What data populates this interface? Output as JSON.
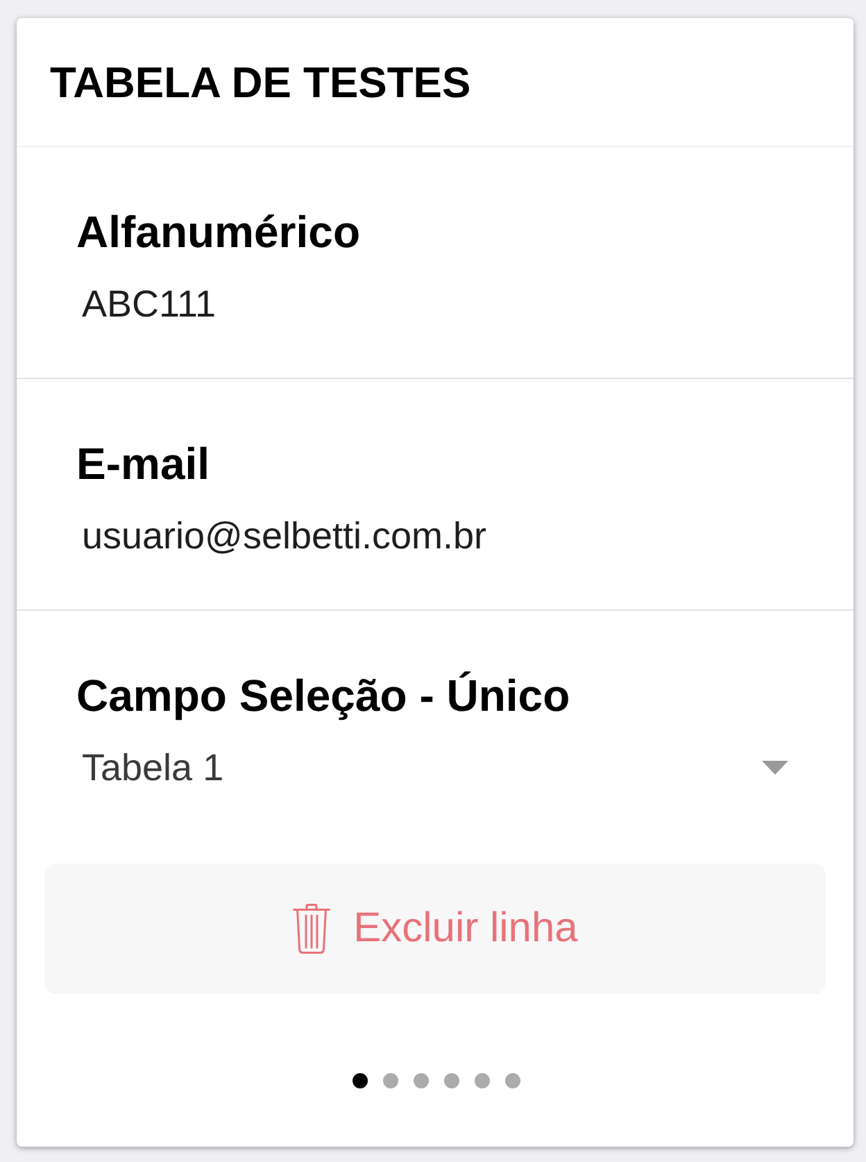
{
  "card": {
    "title": "TABELA DE TESTES"
  },
  "fields": [
    {
      "kind": "text",
      "label": "Alfanumérico",
      "value": "ABC111"
    },
    {
      "kind": "text",
      "label": "E-mail",
      "value": "usuario@selbetti.com.br"
    },
    {
      "kind": "select",
      "label": "Campo Seleção - Único",
      "value": "Tabela 1"
    }
  ],
  "delete_button": {
    "label": "Excluir linha"
  },
  "pager": [
    {
      "selected": true
    },
    {
      "selected": false
    },
    {
      "selected": false
    },
    {
      "selected": false
    },
    {
      "selected": false
    },
    {
      "selected": false
    }
  ]
}
